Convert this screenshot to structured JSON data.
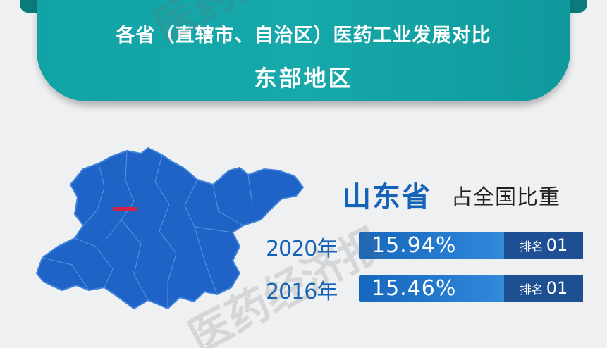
{
  "header": {
    "title": "各省（直辖市、自治区）医药工业发展对比",
    "subtitle": "东部地区"
  },
  "province": {
    "name": "山东省",
    "share_label": "占全国比重"
  },
  "rows": [
    {
      "year": "2020年",
      "percent": "15.94%",
      "rank_label": "排名",
      "rank": "01",
      "share_fraction": 0.1594
    },
    {
      "year": "2016年",
      "percent": "15.46%",
      "rank_label": "排名",
      "rank": "01",
      "share_fraction": 0.1546
    }
  ],
  "watermark": {
    "text": "医药经济报"
  },
  "colors": {
    "header_teal": "#16a8aa",
    "map_blue": "#1f63c6",
    "capital_marker": "#d4224a",
    "rank_navy": "#1d4f92",
    "province_blue": "#1463b8"
  }
}
